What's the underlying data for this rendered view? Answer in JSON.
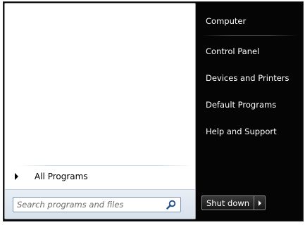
{
  "left_pane": {
    "all_programs_label": "All Programs",
    "search": {
      "placeholder": "Search programs and files",
      "value": ""
    }
  },
  "right_pane": {
    "items": [
      {
        "label": "Computer"
      },
      {
        "label": "Control Panel"
      },
      {
        "label": "Devices and Printers"
      },
      {
        "label": "Default Programs"
      },
      {
        "label": "Help and Support"
      }
    ]
  },
  "shutdown": {
    "label": "Shut down"
  },
  "icons": {
    "all_programs_arrow": "arrow-right-icon",
    "search": "search-icon",
    "shutdown_options": "chevron-right-icon"
  },
  "colors": {
    "frame": "#050505",
    "left_pane_bg": "#ffffff",
    "search_strip_bg": "#dde6f0",
    "right_text": "#ffffff"
  }
}
